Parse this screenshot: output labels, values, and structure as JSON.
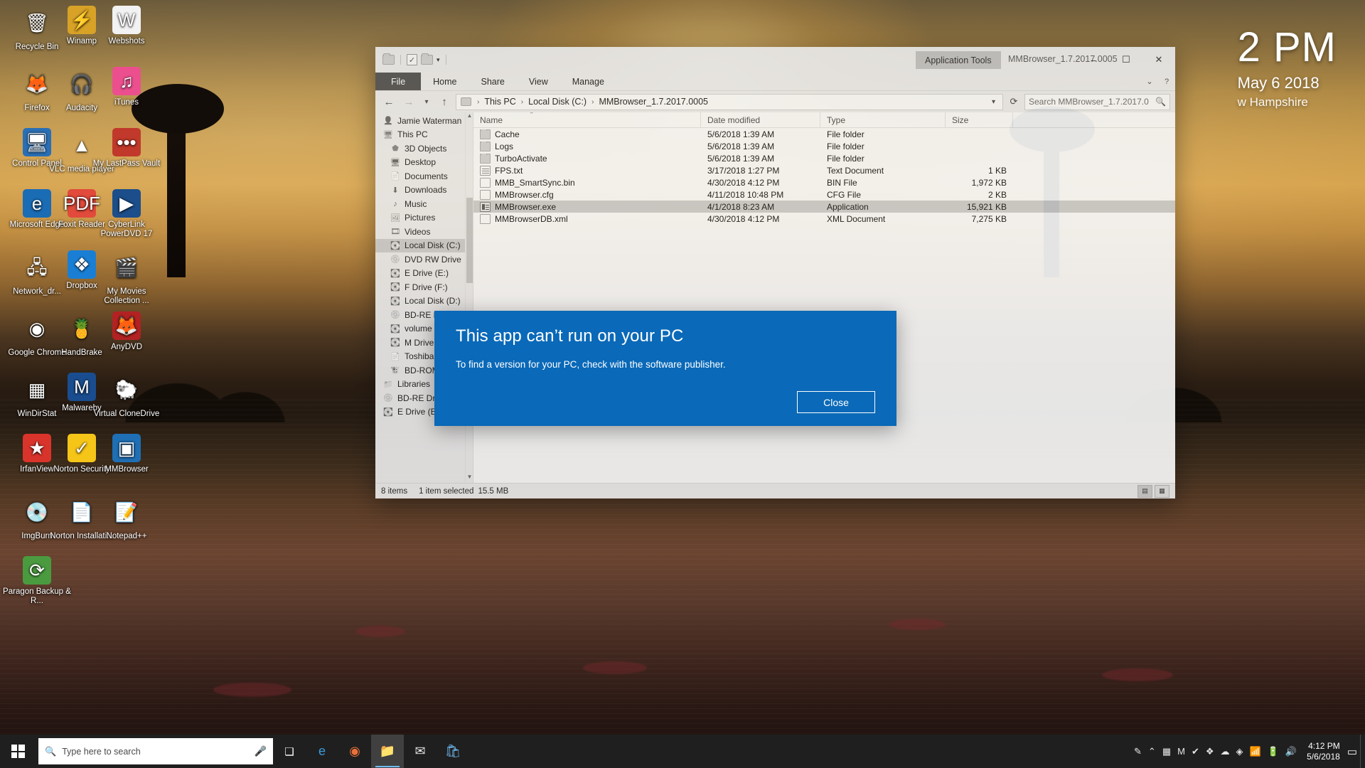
{
  "desktop": {
    "clock_widget": {
      "time": "2 PM",
      "date": "May 6 2018",
      "location": "w Hampshire"
    },
    "icons": [
      {
        "label": "Recycle Bin",
        "icon": "recycle-bin-icon",
        "glyph": "🗑",
        "bg": "transparent"
      },
      {
        "label": "Winamp",
        "icon": "winamp-icon",
        "glyph": "⚡",
        "bg": "#d8a227"
      },
      {
        "label": "Webshots",
        "icon": "webshots-icon",
        "glyph": "W",
        "bg": "#f2f2f2"
      },
      {
        "label": "Firefox",
        "icon": "firefox-icon",
        "glyph": "🦊",
        "bg": "transparent"
      },
      {
        "label": "Audacity",
        "icon": "audacity-icon",
        "glyph": "🎧",
        "bg": "transparent"
      },
      {
        "label": "iTunes",
        "icon": "itunes-icon",
        "glyph": "♫",
        "bg": "#ec4f8e"
      },
      {
        "label": "Control Panel",
        "icon": "control-panel-icon",
        "glyph": "🖥",
        "bg": "#2a6fb5"
      },
      {
        "label": "VLC media player",
        "icon": "vlc-icon",
        "glyph": "▲",
        "bg": "transparent"
      },
      {
        "label": "My LastPass Vault",
        "icon": "lastpass-icon",
        "glyph": "•••",
        "bg": "#c0392b"
      },
      {
        "label": "Microsoft Edge",
        "icon": "edge-icon",
        "glyph": "e",
        "bg": "#1a6cb5"
      },
      {
        "label": "Foxit Reader",
        "icon": "foxit-reader-icon",
        "glyph": "PDF",
        "bg": "#e24a3b"
      },
      {
        "label": "CyberLink PowerDVD 17",
        "icon": "powerdvd-icon",
        "glyph": "▶",
        "bg": "#1b4e8a"
      },
      {
        "label": "Network_dr...",
        "icon": "network-drive-icon",
        "glyph": "🖧",
        "bg": "transparent"
      },
      {
        "label": "Dropbox",
        "icon": "dropbox-icon",
        "glyph": "❖",
        "bg": "#1a7fd4"
      },
      {
        "label": "My Movies Collection ...",
        "icon": "my-movies-icon",
        "glyph": "🎬",
        "bg": "transparent"
      },
      {
        "label": "Google Chrome",
        "icon": "chrome-icon",
        "glyph": "◉",
        "bg": "transparent"
      },
      {
        "label": "HandBrake",
        "icon": "handbrake-icon",
        "glyph": "🍍",
        "bg": "transparent"
      },
      {
        "label": "AnyDVD",
        "icon": "anydvd-icon",
        "glyph": "🦊",
        "bg": "#b22222"
      },
      {
        "label": "WinDirStat",
        "icon": "windirstat-icon",
        "glyph": "▦",
        "bg": "transparent"
      },
      {
        "label": "Malwareby",
        "icon": "malwarebytes-icon",
        "glyph": "M",
        "bg": "#1a4d8f"
      },
      {
        "label": "Virtual CloneDrive",
        "icon": "virtual-clonedrive-icon",
        "glyph": "🐑",
        "bg": "transparent"
      },
      {
        "label": "IrfanView",
        "icon": "irfanview-icon",
        "glyph": "★",
        "bg": "#d9342b"
      },
      {
        "label": "Norton Security",
        "icon": "norton-security-icon",
        "glyph": "✓",
        "bg": "#f5c518"
      },
      {
        "label": "MMBrowser",
        "icon": "mmbrowser-icon",
        "glyph": "▣",
        "bg": "#1f6fb5"
      },
      {
        "label": "ImgBurn",
        "icon": "imgburn-icon",
        "glyph": "💿",
        "bg": "transparent"
      },
      {
        "label": "Norton Installati...",
        "icon": "norton-installer-icon",
        "glyph": "📄",
        "bg": "transparent"
      },
      {
        "label": "Notepad++",
        "icon": "notepadpp-icon",
        "glyph": "📝",
        "bg": "transparent"
      },
      {
        "label": "Paragon Backup & R...",
        "icon": "paragon-backup-icon",
        "glyph": "⟳",
        "bg": "#4a9b3f"
      }
    ]
  },
  "explorer": {
    "window_title": "MMBrowser_1.7.2017.0005",
    "contextual_tab": "Application Tools",
    "quick_access": {
      "new_folder": "new-folder-icon",
      "properties": "properties-icon",
      "customize": "customize-icon"
    },
    "window_controls": {
      "minimize": "–",
      "maximize": "☐",
      "close": "✕",
      "help": "?",
      "ribbon_collapse": "⌄"
    },
    "ribbon_tabs": [
      {
        "label": "File",
        "active": true
      },
      {
        "label": "Home",
        "active": false
      },
      {
        "label": "Share",
        "active": false
      },
      {
        "label": "View",
        "active": false
      },
      {
        "label": "Manage",
        "active": false
      }
    ],
    "nav": {
      "back": "back-arrow-icon",
      "forward": "forward-arrow-icon",
      "recent": "recent-locations-icon",
      "up": "up-arrow-icon",
      "refresh": "refresh-icon",
      "breadcrumbs": [
        "This PC",
        "Local Disk (C:)",
        "MMBrowser_1.7.2017.0005"
      ],
      "search_placeholder": "Search MMBrowser_1.7.2017.0",
      "search_value": ""
    },
    "sidebar": [
      {
        "label": "Jamie Waterman",
        "icon": "user-icon",
        "glyph": "👤",
        "color": "#3f7a3f",
        "level": 0,
        "selected": false,
        "caret": "⌃"
      },
      {
        "label": "This PC",
        "icon": "this-pc-icon",
        "glyph": "🖥",
        "color": "#4a90c2",
        "level": 0,
        "selected": false
      },
      {
        "label": "3D Objects",
        "icon": "3d-objects-icon",
        "glyph": "⬟",
        "color": "#4a90c2",
        "level": 1,
        "selected": false
      },
      {
        "label": "Desktop",
        "icon": "desktop-icon",
        "glyph": "🖥",
        "color": "#2f6fb0",
        "level": 1,
        "selected": false
      },
      {
        "label": "Documents",
        "icon": "documents-icon",
        "glyph": "📄",
        "color": "#6a9ac4",
        "level": 1,
        "selected": false
      },
      {
        "label": "Downloads",
        "icon": "downloads-icon",
        "glyph": "⬇",
        "color": "#2f6fb0",
        "level": 1,
        "selected": false
      },
      {
        "label": "Music",
        "icon": "music-icon",
        "glyph": "♪",
        "color": "#2f6fb0",
        "level": 1,
        "selected": false
      },
      {
        "label": "Pictures",
        "icon": "pictures-icon",
        "glyph": "🖼",
        "color": "#4a90c2",
        "level": 1,
        "selected": false
      },
      {
        "label": "Videos",
        "icon": "videos-icon",
        "glyph": "🎞",
        "color": "#3c6e9a",
        "level": 1,
        "selected": false
      },
      {
        "label": "Local Disk (C:)",
        "icon": "local-disk-c-icon",
        "glyph": "💽",
        "color": "#4a90c2",
        "level": 1,
        "selected": true
      },
      {
        "label": "DVD RW Drive",
        "icon": "dvd-rw-drive-icon",
        "glyph": "💿",
        "color": "#8a8a8a",
        "level": 1,
        "selected": false
      },
      {
        "label": "E Drive (E:)",
        "icon": "e-drive-icon",
        "glyph": "💽",
        "color": "#7a7a7a",
        "level": 1,
        "selected": false
      },
      {
        "label": "F Drive (F:)",
        "icon": "f-drive-icon",
        "glyph": "💽",
        "color": "#7a7a7a",
        "level": 1,
        "selected": false
      },
      {
        "label": "Local Disk (D:)",
        "icon": "local-disk-d-icon",
        "glyph": "💽",
        "color": "#7a7a7a",
        "level": 1,
        "selected": false
      },
      {
        "label": "BD-RE Drive (J:)",
        "icon": "bd-re-drive-icon",
        "glyph": "💿",
        "color": "#8a8a8a",
        "level": 1,
        "selected": false
      },
      {
        "label": "volume (K:)",
        "icon": "volume-drive-icon",
        "glyph": "💽",
        "color": "#3f7a3f",
        "level": 1,
        "selected": false
      },
      {
        "label": "M Drive (M:)",
        "icon": "m-drive-icon",
        "glyph": "💽",
        "color": "#7a7a7a",
        "level": 1,
        "selected": false
      },
      {
        "label": "Toshiba (T:)",
        "icon": "toshiba-drive-icon",
        "glyph": "📄",
        "color": "#9a9a9a",
        "level": 1,
        "selected": false
      },
      {
        "label": "BD-ROM Drive",
        "icon": "bd-rom-drive-icon",
        "glyph": "🐮",
        "color": "#c2a24a",
        "level": 1,
        "selected": false
      },
      {
        "label": "Libraries",
        "icon": "libraries-icon",
        "glyph": "📁",
        "color": "#d2ab43",
        "level": 0,
        "selected": false
      },
      {
        "label": "BD-RE Drive (J:)",
        "icon": "bd-re-drive-j-icon",
        "glyph": "💿",
        "color": "#8a8a8a",
        "level": 0,
        "selected": false
      },
      {
        "label": "E Drive (E:)",
        "icon": "e-drive-bottom-icon",
        "glyph": "💽",
        "color": "#7a7a7a",
        "level": 0,
        "selected": false
      }
    ],
    "columns": [
      {
        "label": "Name",
        "key": "name"
      },
      {
        "label": "Date modified",
        "key": "date"
      },
      {
        "label": "Type",
        "key": "type"
      },
      {
        "label": "Size",
        "key": "size"
      }
    ],
    "sort_indicator": "⌃",
    "files": [
      {
        "name": "Cache",
        "date": "5/6/2018 1:39 AM",
        "type": "File folder",
        "size": "",
        "icon": "folder-icon",
        "kind": "folder",
        "selected": false
      },
      {
        "name": "Logs",
        "date": "5/6/2018 1:39 AM",
        "type": "File folder",
        "size": "",
        "icon": "folder-icon",
        "kind": "folder",
        "selected": false
      },
      {
        "name": "TurboActivate",
        "date": "5/6/2018 1:39 AM",
        "type": "File folder",
        "size": "",
        "icon": "folder-icon",
        "kind": "folder",
        "selected": false
      },
      {
        "name": "FPS.txt",
        "date": "3/17/2018 1:27 PM",
        "type": "Text Document",
        "size": "1 KB",
        "icon": "text-file-icon",
        "kind": "txt",
        "selected": false
      },
      {
        "name": "MMB_SmartSync.bin",
        "date": "4/30/2018 4:12 PM",
        "type": "BIN File",
        "size": "1,972 KB",
        "icon": "generic-file-icon",
        "kind": "doc",
        "selected": false
      },
      {
        "name": "MMBrowser.cfg",
        "date": "4/11/2018 10:48 PM",
        "type": "CFG File",
        "size": "2 KB",
        "icon": "generic-file-icon",
        "kind": "doc",
        "selected": false
      },
      {
        "name": "MMBrowser.exe",
        "date": "4/1/2018 8:23 AM",
        "type": "Application",
        "size": "15,921 KB",
        "icon": "application-icon",
        "kind": "app",
        "selected": true
      },
      {
        "name": "MMBrowserDB.xml",
        "date": "4/30/2018 4:12 PM",
        "type": "XML Document",
        "size": "7,275 KB",
        "icon": "xml-file-icon",
        "kind": "doc",
        "selected": false
      }
    ],
    "status": {
      "item_count": "8 items",
      "selection": "1 item selected",
      "selection_size": "15.5 MB",
      "view_details": "details-view-icon",
      "view_large": "large-icons-view-icon"
    }
  },
  "dialog": {
    "title": "This app can’t run on your PC",
    "message": "To find a version for your PC, check with the software publisher.",
    "close_label": "Close",
    "accent_color": "#0a69b8"
  },
  "taskbar": {
    "start": "windows-start-icon",
    "search_placeholder": "Type here to search",
    "mic": "microphone-icon",
    "task_view": "task-view-icon",
    "pinned": [
      {
        "name": "edge-taskbar-icon",
        "glyph": "e",
        "color": "#3a9bdc",
        "active": false
      },
      {
        "name": "firefox-taskbar-icon",
        "glyph": "◉",
        "color": "#e8703a",
        "active": false
      },
      {
        "name": "file-explorer-taskbar-icon",
        "glyph": "📁",
        "color": "#f0c040",
        "active": true
      },
      {
        "name": "mail-taskbar-icon",
        "glyph": "✉",
        "color": "#e4e4e4",
        "active": false
      },
      {
        "name": "store-taskbar-icon",
        "glyph": "🛍",
        "color": "#6fbbf2",
        "active": false
      }
    ],
    "tray": [
      {
        "name": "pen-tray-icon",
        "glyph": "✎"
      },
      {
        "name": "show-hidden-icons-tray-icon",
        "glyph": "⌃"
      },
      {
        "name": "windirstat-tray-icon",
        "glyph": "▦"
      },
      {
        "name": "malwarebytes-tray-icon",
        "glyph": "M"
      },
      {
        "name": "norton-tray-icon",
        "glyph": "✔"
      },
      {
        "name": "dropbox-tray-icon",
        "glyph": "❖"
      },
      {
        "name": "cloud-tray-icon",
        "glyph": "☁"
      },
      {
        "name": "nvidia-tray-icon",
        "glyph": "◈"
      },
      {
        "name": "network-tray-icon",
        "glyph": "📶"
      },
      {
        "name": "battery-tray-icon",
        "glyph": "🔋"
      },
      {
        "name": "volume-tray-icon",
        "glyph": "🔊"
      }
    ],
    "clock": {
      "time": "4:12 PM",
      "date": "5/6/2018"
    },
    "notifications": "action-center-icon"
  }
}
